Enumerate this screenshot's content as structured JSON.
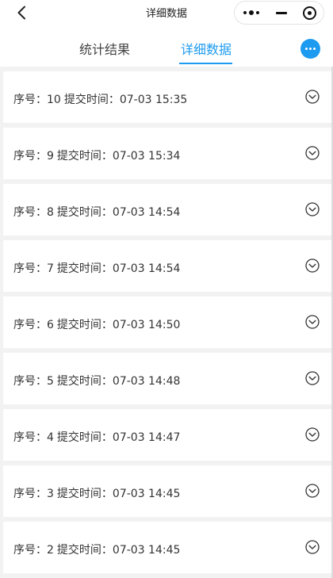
{
  "navbar": {
    "title": "详细数据",
    "icons": {
      "back": "chevron-left-icon",
      "more": "more-dots-icon",
      "minimize": "minimize-icon",
      "close": "target-close-icon"
    }
  },
  "tabs": [
    {
      "label": "统计结果",
      "active": false
    },
    {
      "label": "详细数据",
      "active": true
    }
  ],
  "accent_color": "#1d9bf0",
  "records": [
    {
      "seq_label": "序号：",
      "seq": "10",
      "time_label": "提交时间：",
      "time": "07-03 15:35"
    },
    {
      "seq_label": "序号：",
      "seq": "9",
      "time_label": "提交时间：",
      "time": "07-03 15:34"
    },
    {
      "seq_label": "序号：",
      "seq": "8",
      "time_label": "提交时间：",
      "time": "07-03 14:54"
    },
    {
      "seq_label": "序号：",
      "seq": "7",
      "time_label": "提交时间：",
      "time": "07-03 14:54"
    },
    {
      "seq_label": "序号：",
      "seq": "6",
      "time_label": "提交时间：",
      "time": "07-03 14:50"
    },
    {
      "seq_label": "序号：",
      "seq": "5",
      "time_label": "提交时间：",
      "time": "07-03 14:48"
    },
    {
      "seq_label": "序号：",
      "seq": "4",
      "time_label": "提交时间：",
      "time": "07-03 14:47"
    },
    {
      "seq_label": "序号：",
      "seq": "3",
      "time_label": "提交时间：",
      "time": "07-03 14:45"
    },
    {
      "seq_label": "序号：",
      "seq": "2",
      "time_label": "提交时间：",
      "time": "07-03 14:45"
    }
  ]
}
